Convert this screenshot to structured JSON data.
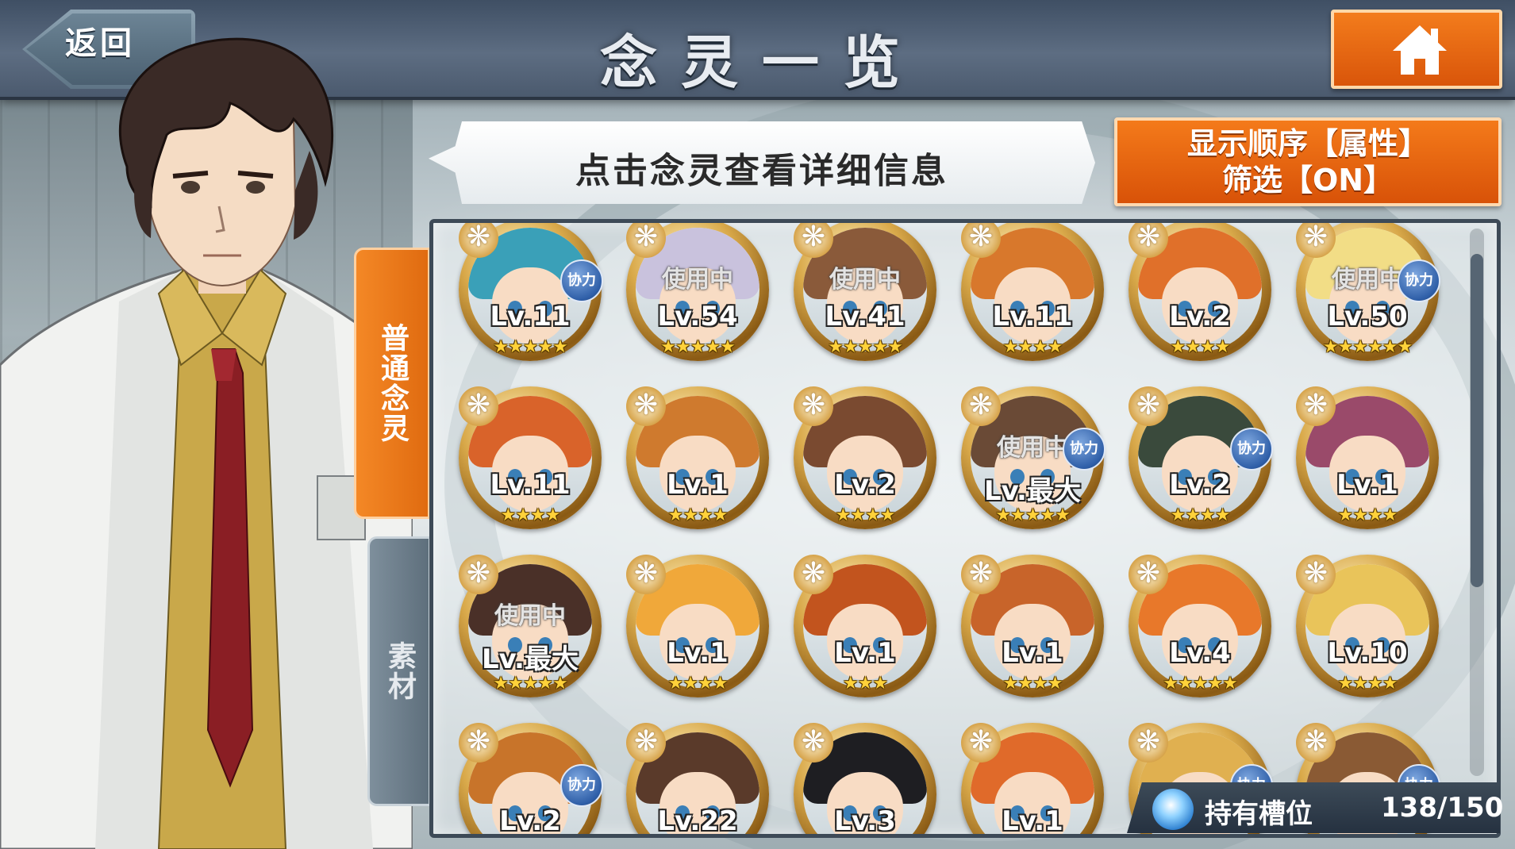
{
  "header": {
    "back_label": "返回",
    "title": "念灵一览"
  },
  "hint": "点击念灵查看详细信息",
  "sort_button": {
    "line1": "显示顺序【属性】",
    "line2": "筛选【ON】"
  },
  "tabs": [
    {
      "label": "普通念灵",
      "active": true
    },
    {
      "label": "素材",
      "active": false
    }
  ],
  "slots": {
    "label": "持有槽位",
    "value": "138/150"
  },
  "inuse_text": "使用中",
  "coop_text": "协力",
  "cards": [
    {
      "level": "Lv.11",
      "stars": 5,
      "inuse": false,
      "coop": true,
      "hair": "#3aa0b8"
    },
    {
      "level": "Lv.54",
      "stars": 5,
      "inuse": true,
      "coop": false,
      "hair": "#c9c2dd"
    },
    {
      "level": "Lv.41",
      "stars": 5,
      "inuse": true,
      "coop": false,
      "hair": "#8a5a3a"
    },
    {
      "level": "Lv.11",
      "stars": 4,
      "inuse": false,
      "coop": false,
      "hair": "#d8782c"
    },
    {
      "level": "Lv.2",
      "stars": 4,
      "inuse": false,
      "coop": false,
      "hair": "#e0702a"
    },
    {
      "level": "Lv.50",
      "stars": 6,
      "inuse": true,
      "coop": true,
      "hair": "#f2dd86"
    },
    {
      "level": "Lv.11",
      "stars": 4,
      "inuse": false,
      "coop": false,
      "hair": "#d9632a"
    },
    {
      "level": "Lv.1",
      "stars": 4,
      "inuse": false,
      "coop": false,
      "hair": "#cf7a2e"
    },
    {
      "level": "Lv.2",
      "stars": 4,
      "inuse": false,
      "coop": false,
      "hair": "#7a4a30"
    },
    {
      "level": "Lv.最大",
      "stars": 5,
      "inuse": true,
      "coop": true,
      "hair": "#6a4a36"
    },
    {
      "level": "Lv.2",
      "stars": 4,
      "inuse": false,
      "coop": true,
      "hair": "#3a4a3c"
    },
    {
      "level": "Lv.1",
      "stars": 4,
      "inuse": false,
      "coop": false,
      "hair": "#9a4a6a"
    },
    {
      "level": "Lv.最大",
      "stars": 5,
      "inuse": true,
      "coop": false,
      "hair": "#4a3028"
    },
    {
      "level": "Lv.1",
      "stars": 4,
      "inuse": false,
      "coop": false,
      "hair": "#f0a83a"
    },
    {
      "level": "Lv.1",
      "stars": 3,
      "inuse": false,
      "coop": false,
      "hair": "#c2541e"
    },
    {
      "level": "Lv.1",
      "stars": 4,
      "inuse": false,
      "coop": false,
      "hair": "#c8642a"
    },
    {
      "level": "Lv.4",
      "stars": 5,
      "inuse": false,
      "coop": false,
      "hair": "#e8782a"
    },
    {
      "level": "Lv.10",
      "stars": 4,
      "inuse": false,
      "coop": false,
      "hair": "#e9c45a"
    },
    {
      "level": "Lv.2",
      "stars": 4,
      "inuse": false,
      "coop": true,
      "hair": "#c8742a"
    },
    {
      "level": "Lv.22",
      "stars": 4,
      "inuse": false,
      "coop": false,
      "hair": "#5a3a2a"
    },
    {
      "level": "Lv.3",
      "stars": 4,
      "inuse": false,
      "coop": false,
      "hair": "#1e1e22"
    },
    {
      "level": "Lv.1",
      "stars": 4,
      "inuse": false,
      "coop": false,
      "hair": "#e06a2a"
    },
    {
      "level": "",
      "stars": 0,
      "inuse": false,
      "coop": true,
      "hair": "#e0b050"
    },
    {
      "level": "",
      "stars": 0,
      "inuse": false,
      "coop": true,
      "hair": "#8a5a34"
    }
  ],
  "colors": {
    "accent_orange": "#e86a12",
    "topbar": "#4b5a6e",
    "coop_blue": "#2f5fa8",
    "star_gold": "#ffd23a"
  },
  "icons": [
    "home-icon",
    "slot-orb-icon",
    "petal-badge-icon"
  ]
}
